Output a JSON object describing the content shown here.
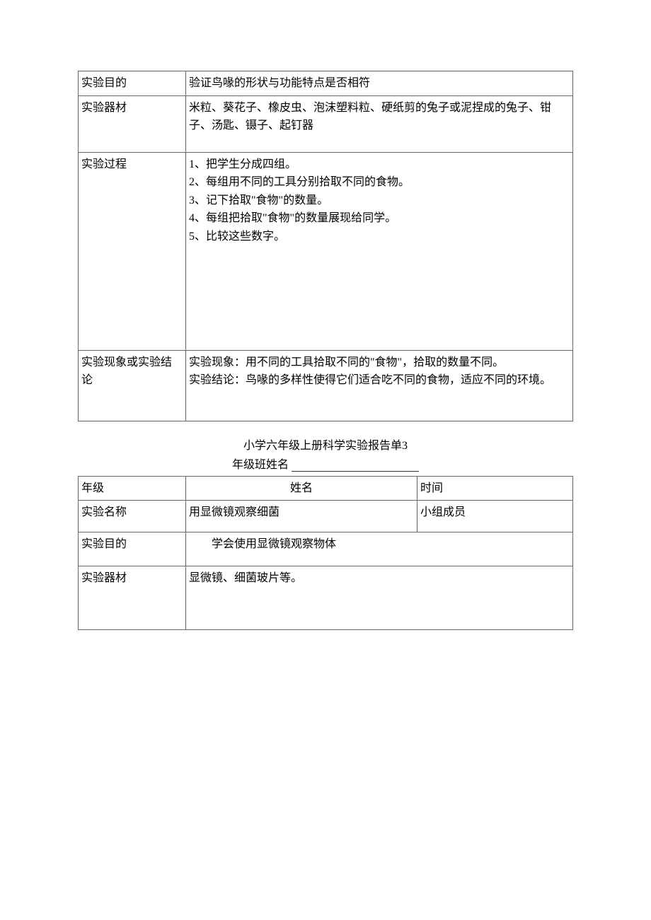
{
  "table1": {
    "rows": {
      "purpose": {
        "label": "实验目的",
        "content": "验证鸟喙的形状与功能特点是否相符"
      },
      "equipment": {
        "label": "实验器材",
        "content": "米粒、葵花子、橡皮虫、泡沫塑料粒、硬纸剪的兔子或泥捏成的兔子、钳子、汤匙、镊子、起钉器"
      },
      "process": {
        "label": "实验过程",
        "items": [
          "1、把学生分成四组。",
          "2、每组用不同的工具分别拾取不同的食物。",
          "3、记下拾取\"食物\"的数量。",
          "4、每组把拾取\"食物\"的数量展现给同学。",
          "5、比较这些数字。"
        ]
      },
      "conclusion": {
        "label": "实验现象或实验结论",
        "line1": "实验现象：用不同的工具拾取不同的\"食物\"，拾取的数量不同。",
        "line2": "实验结论：鸟喙的多样性使得它们适合吃不同的食物，适应不同的环境。"
      }
    }
  },
  "section": {
    "title": "小学六年级上册科学实验报告单3",
    "subtitle_prefix": "年级班姓名"
  },
  "table2": {
    "row1": {
      "c1": "年级",
      "c2": "姓名",
      "c3": "时间"
    },
    "row2": {
      "c1": "实验名称",
      "c2": "用显微镜观察细菌",
      "c3": "小组成员"
    },
    "row3": {
      "c1": "实验目的",
      "c2": "学会使用显微镜观察物体"
    },
    "row4": {
      "c1": "实验器材",
      "c2": "显微镜、细菌玻片等。"
    }
  }
}
